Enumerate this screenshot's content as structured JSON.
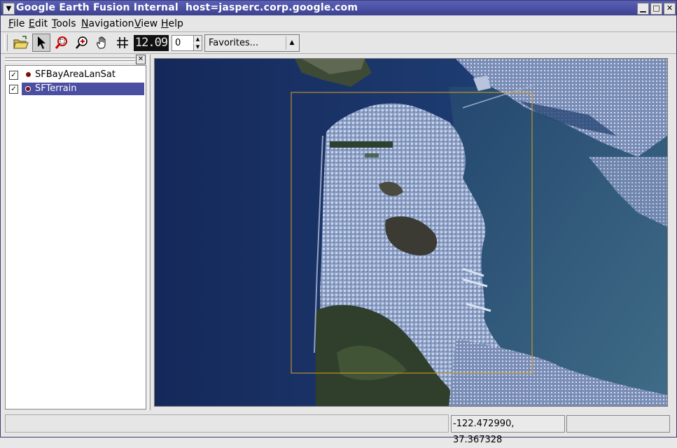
{
  "window": {
    "title": "Google Earth Fusion Internal  host=jasperc.corp.google.com",
    "menu_icon": "window-menu-icon",
    "minimize_glyph": "▁",
    "maximize_glyph": "□",
    "close_glyph": "✕"
  },
  "menubar": {
    "items": [
      "File",
      "Edit",
      "Tools",
      "Navigation",
      "View",
      "Help"
    ]
  },
  "toolbar": {
    "icons": [
      "open-folder-icon",
      "select-arrow-icon",
      "zoom-box-icon",
      "zoom-in-icon",
      "pan-hand-icon",
      "grid-icon"
    ],
    "lcd_value": "12.09",
    "spin_value": "0",
    "favorites_label": "Favorites..."
  },
  "layers": {
    "items": [
      {
        "label": "SFBayAreaLanSat",
        "checked": true,
        "selected": false
      },
      {
        "label": "SFTerrain",
        "checked": true,
        "selected": true
      }
    ],
    "dot_color": "#7a1010"
  },
  "map": {
    "selection_box_color": "#e0a020",
    "water_color": "#1c3466"
  },
  "statusbar": {
    "coordinates": "-122.472990, 37.367328"
  }
}
